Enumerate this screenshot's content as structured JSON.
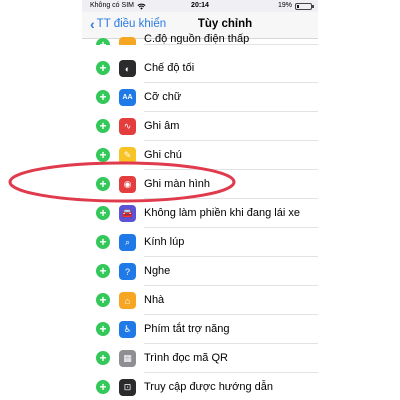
{
  "status": {
    "carrier": "Không có SIM",
    "time": "20:14",
    "battery_percent": "19%",
    "battery_level": 0.19
  },
  "nav": {
    "back_label": "TT điều khiển",
    "title": "Tùy chỉnh"
  },
  "rows": [
    {
      "label": "C.độ nguồn điện thấp",
      "icon": "battery-icon",
      "color": "#f6a623"
    },
    {
      "label": "Chế độ tối",
      "icon": "dark-mode-icon",
      "color": "#2b2b2d"
    },
    {
      "label": "Cỡ chữ",
      "icon": "text-size-icon",
      "color": "#1f7ae8"
    },
    {
      "label": "Ghi âm",
      "icon": "voice-memo-icon",
      "color": "#e43d3d"
    },
    {
      "label": "Ghi chú",
      "icon": "notes-icon",
      "color": "#f7c325"
    },
    {
      "label": "Ghi màn hình",
      "icon": "screen-record-icon",
      "color": "#e43d3d"
    },
    {
      "label": "Không làm phiền khi đang lái xe",
      "icon": "car-icon",
      "color": "#5b52d6"
    },
    {
      "label": "Kính lúp",
      "icon": "magnifier-icon",
      "color": "#1f7ae8"
    },
    {
      "label": "Nghe",
      "icon": "ear-icon",
      "color": "#1f7ae8"
    },
    {
      "label": "Nhà",
      "icon": "home-icon",
      "color": "#f6a623"
    },
    {
      "label": "Phím tắt trợ năng",
      "icon": "accessibility-icon",
      "color": "#1f7ae8"
    },
    {
      "label": "Trình đọc mã QR",
      "icon": "qr-code-icon",
      "color": "#8e8e93"
    },
    {
      "label": "Truy cập được hướng dẫn",
      "icon": "guided-access-icon",
      "color": "#2b2b2d"
    }
  ],
  "highlight_color": "#e03a4d"
}
